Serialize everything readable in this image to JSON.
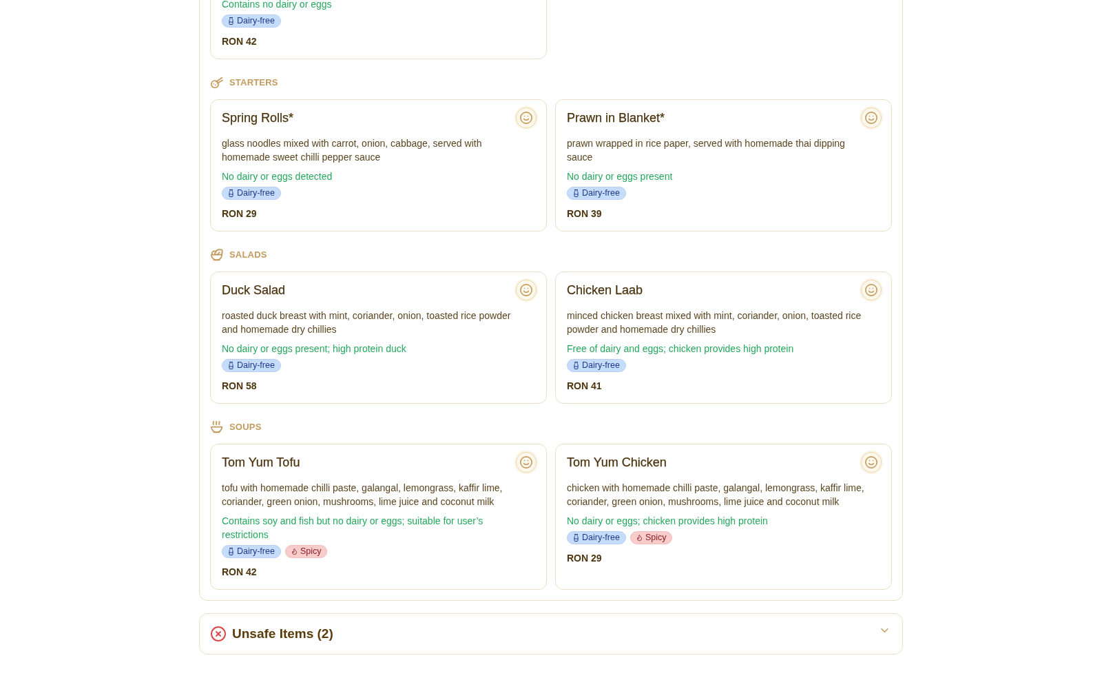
{
  "sections": [
    {
      "items": [
        {
          "note": "Contains no dairy or eggs",
          "tags": [
            {
              "kind": "dairy",
              "label": "Dairy-free"
            }
          ],
          "price": "RON 42"
        }
      ]
    },
    {
      "kind": "starters",
      "title": "STARTERS",
      "items": [
        {
          "name": "Spring Rolls*",
          "description": "glass noodles mixed with carrot, onion, cabbage, served with homemade sweet chilli pepper sauce",
          "note": "No dairy or eggs detected",
          "tags": [
            {
              "kind": "dairy",
              "label": "Dairy-free"
            }
          ],
          "price": "RON 29"
        },
        {
          "name": "Prawn in Blanket*",
          "description": "prawn wrapped in rice paper, served with homemade thai dipping sauce",
          "note": "No dairy or eggs present",
          "tags": [
            {
              "kind": "dairy",
              "label": "Dairy-free"
            }
          ],
          "price": "RON 39"
        }
      ]
    },
    {
      "kind": "salads",
      "title": "SALADS",
      "items": [
        {
          "name": "Duck Salad",
          "description": "roasted duck breast with mint, coriander, onion, toasted rice powder and homemade dry chillies",
          "note": "No dairy or eggs present; high protein duck",
          "tags": [
            {
              "kind": "dairy",
              "label": "Dairy-free"
            }
          ],
          "price": "RON 58"
        },
        {
          "name": "Chicken Laab",
          "description": "minced chicken breast mixed with mint, coriander, onion, toasted rice powder and homemade dry chillies",
          "note": "Free of dairy and eggs; chicken provides high protein",
          "tags": [
            {
              "kind": "dairy",
              "label": "Dairy-free"
            }
          ],
          "price": "RON 41"
        }
      ]
    },
    {
      "kind": "soups",
      "title": "SOUPS",
      "items": [
        {
          "name": "Tom Yum Tofu",
          "description": "tofu with homemade chilli paste, galangal, lemongrass, kaffir lime, coriander, green onion, mushrooms, lime juice and coconut milk",
          "note": "Contains soy and fish but no dairy or eggs; suitable for user’s restrictions",
          "tags": [
            {
              "kind": "dairy",
              "label": "Dairy-free"
            },
            {
              "kind": "spicy",
              "label": "Spicy"
            }
          ],
          "price": "RON 42"
        },
        {
          "name": "Tom Yum Chicken",
          "description": "chicken with homemade chilli paste, galangal, lemongrass, kaffir lime, coriander, green onion, mushrooms, lime juice and coconut milk",
          "note": "No dairy or eggs; chicken provides high protein",
          "tags": [
            {
              "kind": "dairy",
              "label": "Dairy-free"
            },
            {
              "kind": "spicy",
              "label": "Spicy"
            }
          ],
          "price": "RON 29"
        }
      ]
    }
  ],
  "unsafe": {
    "title": "Unsafe Items (2)",
    "expanded": false
  }
}
